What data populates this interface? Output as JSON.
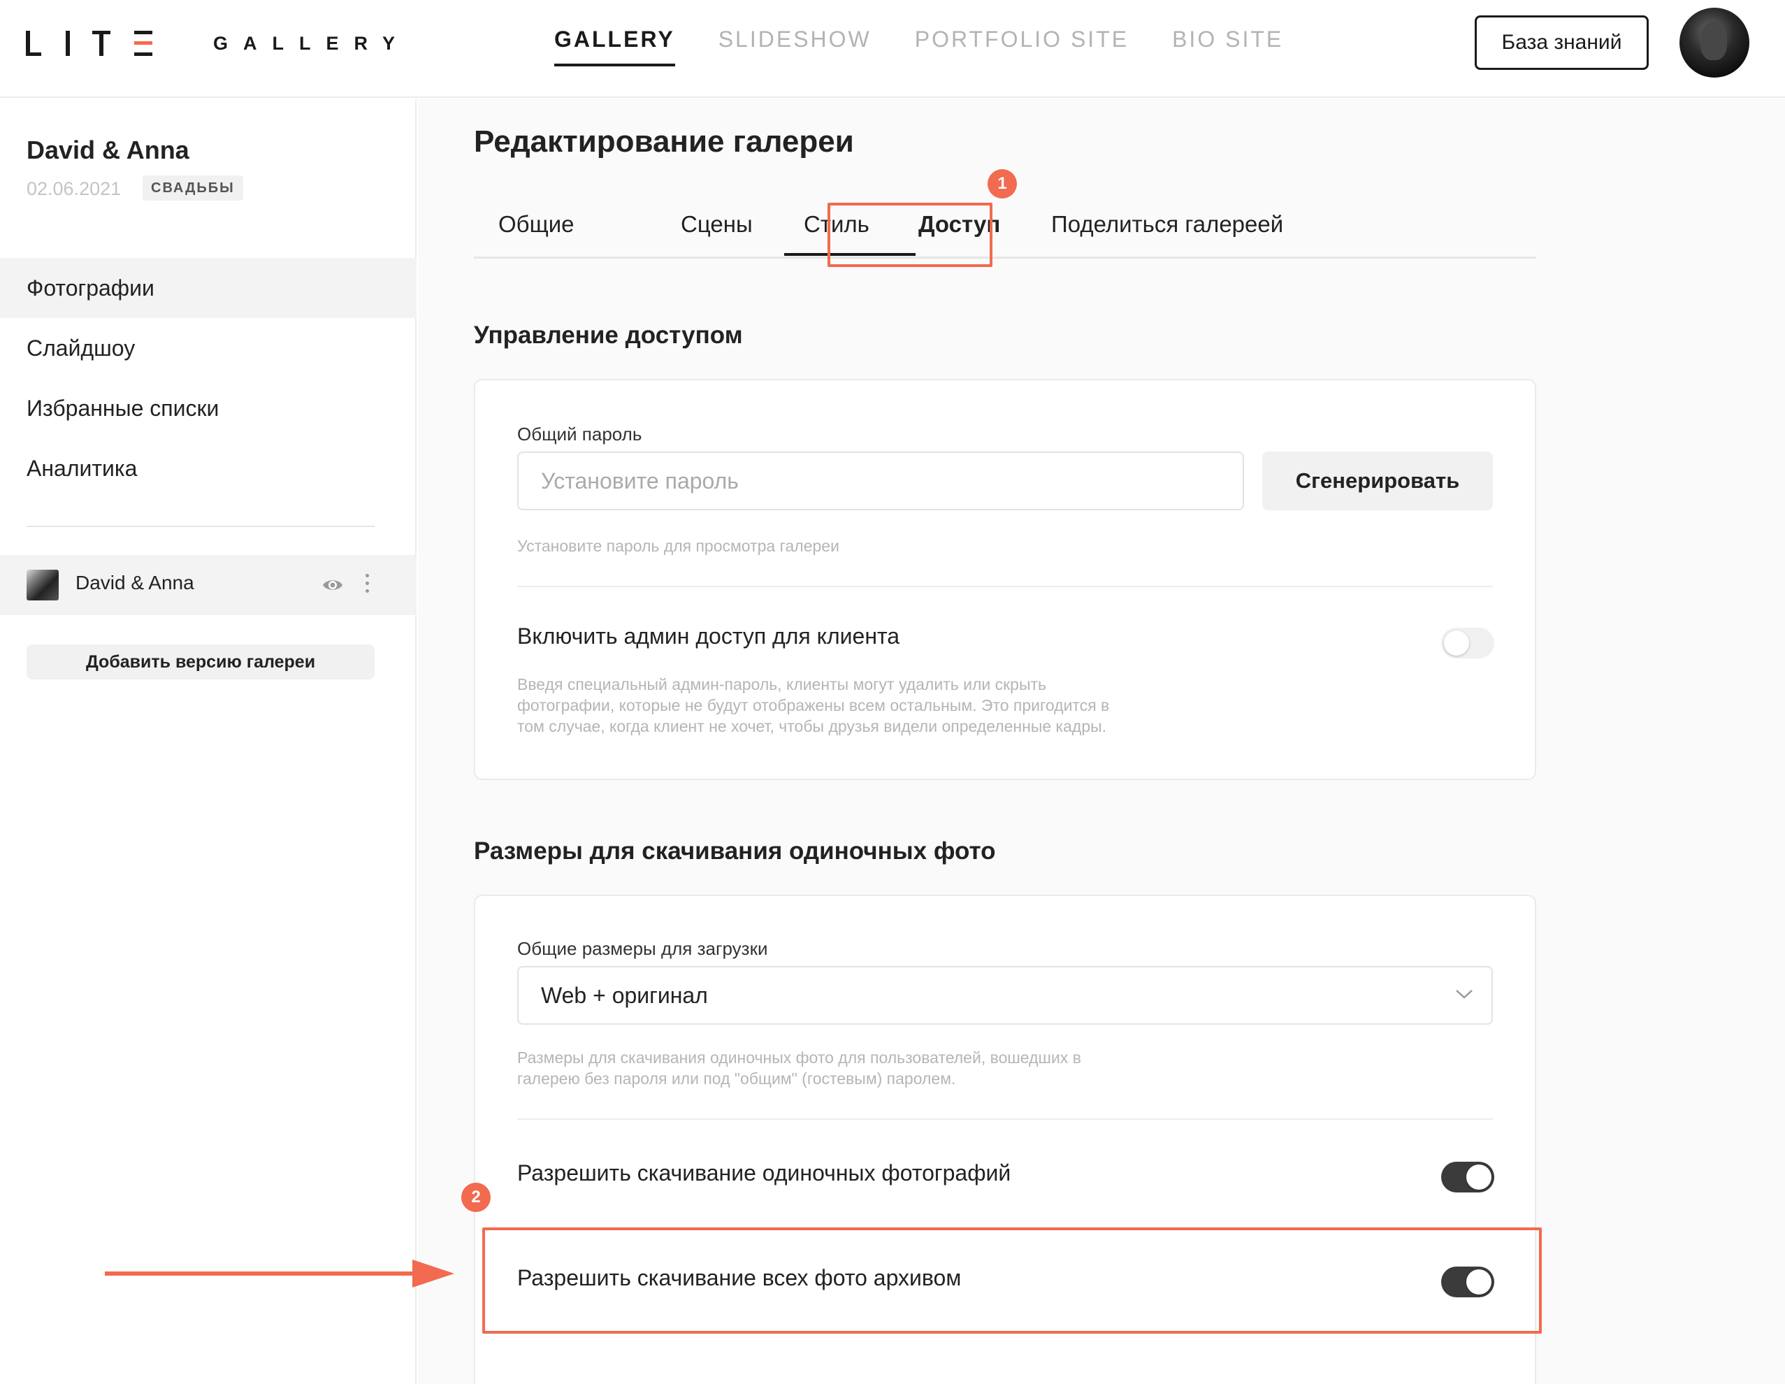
{
  "header": {
    "logo_mark": "LITE",
    "logo_text": "GALLERY",
    "nav": [
      {
        "label": "GALLERY",
        "active": true
      },
      {
        "label": "SLIDESHOW",
        "active": false
      },
      {
        "label": "PORTFOLIO SITE",
        "active": false
      },
      {
        "label": "BIO SITE",
        "active": false
      }
    ],
    "kb_button": "База знаний",
    "avatar_icon": "user-avatar-photo"
  },
  "sidebar": {
    "gallery_title": "David & Anna",
    "gallery_date": "02.06.2021",
    "gallery_tag": "СВАДЬБЫ",
    "menu": [
      {
        "label": "Фотографии",
        "active": true
      },
      {
        "label": "Слайдшоу",
        "active": false
      },
      {
        "label": "Избранные списки",
        "active": false
      },
      {
        "label": "Аналитика",
        "active": false
      }
    ],
    "version_label": "David & Anna",
    "add_version": "Добавить версию галереи"
  },
  "main": {
    "title": "Редактирование галереи",
    "tabs": [
      {
        "label": "Общие",
        "active": false
      },
      {
        "label": "Сцены",
        "active": false
      },
      {
        "label": "Стиль",
        "active": false
      },
      {
        "label": "Доступ",
        "active": true
      },
      {
        "label": "Поделиться галереей",
        "active": false
      }
    ],
    "access": {
      "section_title": "Управление доступом",
      "password_label": "Общий пароль",
      "password_value": "",
      "password_placeholder": "Установите пароль",
      "generate_button": "Сгенерировать",
      "password_hint": "Установите пароль для просмотра галереи",
      "admin_label": "Включить админ доступ для клиента",
      "admin_enabled": false,
      "admin_hint_lines": [
        "Введя специальный админ-пароль, клиенты могут удалить или скрыть",
        "фотографии, которые не будут отображены всем остальным. Это пригодится в",
        "том случае, когда клиент не хочет, чтобы друзья видели определенные кадры."
      ]
    },
    "downloads": {
      "section_title": "Размеры для скачивания одиночных фото",
      "sizes_label": "Общие размеры для загрузки",
      "sizes_value": "Web + оригинал",
      "sizes_hint_lines": [
        "Размеры для скачивания одиночных фото для пользователей, вошедших в",
        "галерею без пароля или под \"общим\" (гостевым) паролем."
      ],
      "single_label": "Разрешить скачивание одиночных фотографий",
      "single_enabled": true,
      "archive_label": "Разрешить скачивание всех фото архивом",
      "archive_enabled": true
    }
  },
  "annotations": {
    "badge_1": "1",
    "badge_2": "2",
    "accent_color": "#f26a4f"
  }
}
